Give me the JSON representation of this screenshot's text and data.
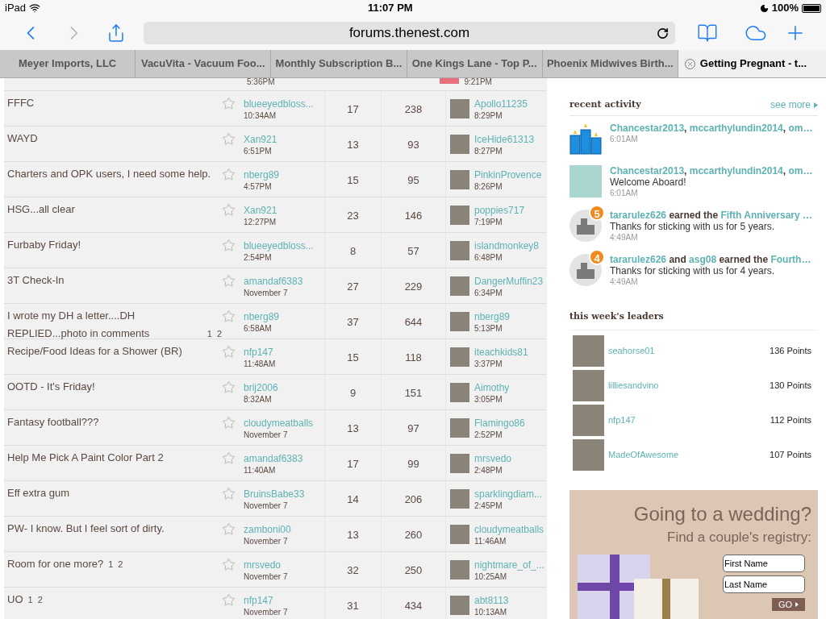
{
  "status_bar": {
    "device": "iPad",
    "time": "11:07 PM",
    "battery": "100%"
  },
  "toolbar": {
    "url": "forums.thenest.com"
  },
  "tabs": [
    {
      "label": "Meyer Imports, LLC",
      "selected": false
    },
    {
      "label": "VacuVita - Vacuum Foo...",
      "selected": false
    },
    {
      "label": "Monthly Subscription B...",
      "selected": false
    },
    {
      "label": "One Kings Lane - Top P...",
      "selected": false
    },
    {
      "label": "Phoenix Midwives Birth...",
      "selected": false
    },
    {
      "label": "Getting Pregnant - t...",
      "selected": true
    }
  ],
  "topics": {
    "partial_row": {
      "started_time": "5:36PM",
      "last_time": "9:21PM"
    },
    "rows": [
      {
        "title": "FFFC",
        "starter": "blueeyedbloss...",
        "started": "10:34AM",
        "replies": "17",
        "posts": "238",
        "last_user": "Apollo11235",
        "last_time": "8:29PM"
      },
      {
        "title": "WAYD",
        "starter": "Xan921",
        "started": "6:51PM",
        "replies": "13",
        "posts": "93",
        "last_user": "IceHide61313",
        "last_time": "8:27PM"
      },
      {
        "title": "Charters and OPK users, I need some help.",
        "starter": "nberg89",
        "started": "4:57PM",
        "replies": "15",
        "posts": "95",
        "last_user": "PinkinProvence",
        "last_time": "8:26PM"
      },
      {
        "title": "HSG...all clear",
        "starter": "Xan921",
        "started": "12:27PM",
        "replies": "23",
        "posts": "146",
        "last_user": "poppies717",
        "last_time": "7:19PM"
      },
      {
        "title": "Furbaby Friday!",
        "starter": "blueeyedbloss...",
        "started": "2:54PM",
        "replies": "8",
        "posts": "57",
        "last_user": "islandmonkey8",
        "last_time": "6:48PM"
      },
      {
        "title": "3T Check-In",
        "starter": "amandaf6383",
        "started": "November 7",
        "replies": "27",
        "posts": "229",
        "last_user": "DangerMuffin23",
        "last_time": "6:34PM"
      },
      {
        "title": "I wrote my DH a letter....DH REPLIED...photo in comments",
        "pages": [
          "1",
          "2"
        ],
        "starter": "nberg89",
        "started": "6:58AM",
        "replies": "37",
        "posts": "644",
        "last_user": "nberg89",
        "last_time": "5:13PM"
      },
      {
        "title": "Recipe/Food Ideas for a Shower (BR)",
        "starter": "nfp147",
        "started": "11:48AM",
        "replies": "15",
        "posts": "118",
        "last_user": "iteachkids81",
        "last_time": "3:37PM"
      },
      {
        "title": "OOTD - It's Friday!",
        "starter": "brij2006",
        "started": "8:32AM",
        "replies": "9",
        "posts": "151",
        "last_user": "Aimothy",
        "last_time": "3:05PM"
      },
      {
        "title": "Fantasy football???",
        "starter": "cloudymeatballs",
        "started": "November 7",
        "replies": "13",
        "posts": "97",
        "last_user": "Flamingo86",
        "last_time": "2:52PM"
      },
      {
        "title": "Help Me Pick A Paint Color Part 2",
        "starter": "amandaf6383",
        "started": "11:40AM",
        "replies": "17",
        "posts": "99",
        "last_user": "mrsvedo",
        "last_time": "2:48PM"
      },
      {
        "title": "Eff extra gum",
        "starter": "BruinsBabe33",
        "started": "November 7",
        "replies": "14",
        "posts": "206",
        "last_user": "sparklingdiam...",
        "last_time": "2:45PM"
      },
      {
        "title": "PW- I know. But I feel sort of dirty.",
        "starter": "zamboni00",
        "started": "November 7",
        "replies": "13",
        "posts": "260",
        "last_user": "cloudymeatballs",
        "last_time": "11:46AM"
      },
      {
        "title": "Room for one more?",
        "pages": [
          "1",
          "2"
        ],
        "starter": "mrsvedo",
        "started": "November 7",
        "replies": "32",
        "posts": "250",
        "last_user": "nightmare_of_...",
        "last_time": "10:25AM"
      },
      {
        "title": "UO",
        "pages": [
          "1",
          "2"
        ],
        "starter": "nfp147",
        "started": "November 7",
        "replies": "31",
        "posts": "434",
        "last_user": "abt8113",
        "last_time": "10:13AM"
      }
    ]
  },
  "recent_activity": {
    "title": "recent activity",
    "see_more": "see more",
    "items": [
      {
        "kind": "podium",
        "parts": [
          {
            "text": "Chancestar2013",
            "link": true
          },
          {
            "text": ", ",
            "link": false
          },
          {
            "text": "mccarthylundin2014",
            "link": true
          },
          {
            "text": ", ",
            "link": false
          },
          {
            "text": "om…",
            "link": true
          }
        ],
        "time": "6:01AM"
      },
      {
        "kind": "photo",
        "parts": [
          {
            "text": "Chancestar2013",
            "link": true
          },
          {
            "text": ", ",
            "link": false
          },
          {
            "text": "mccarthylundin2014",
            "link": true
          },
          {
            "text": ", ",
            "link": false
          },
          {
            "text": "om…",
            "link": true
          }
        ],
        "message": "Welcome Aboard!",
        "time": "6:01AM"
      },
      {
        "kind": "badge",
        "badge": "5",
        "parts": [
          {
            "text": "tararulez626",
            "link": true
          },
          {
            "text": " earned the ",
            "link": false
          },
          {
            "text": "Fifth Anniversary …",
            "link": true
          }
        ],
        "message": "Thanks for sticking with us for 5 years.",
        "time": "4:49AM"
      },
      {
        "kind": "badge",
        "badge": "4",
        "parts": [
          {
            "text": "tararulez626",
            "link": true
          },
          {
            "text": " and ",
            "link": false
          },
          {
            "text": "asg08",
            "link": true
          },
          {
            "text": " earned the ",
            "link": false
          },
          {
            "text": "Fourth…",
            "link": true
          }
        ],
        "message": "Thanks for sticking with us for 4 years.",
        "time": "4:49AM"
      }
    ]
  },
  "leaders": {
    "title": "this week's leaders",
    "items": [
      {
        "name": "seahorse01",
        "points": "136 Points"
      },
      {
        "name": "lilliesandvino",
        "points": "130 Points"
      },
      {
        "name": "nfp147",
        "points": "112 Points"
      },
      {
        "name": "MadeOfAwesome",
        "points": "107 Points"
      }
    ]
  },
  "ad": {
    "heading": "Going to a wedding?",
    "subheading": "Find a couple's registry:",
    "fields": [
      {
        "placeholder": "First Name"
      },
      {
        "placeholder": "Last Name"
      }
    ],
    "button": "GO"
  }
}
